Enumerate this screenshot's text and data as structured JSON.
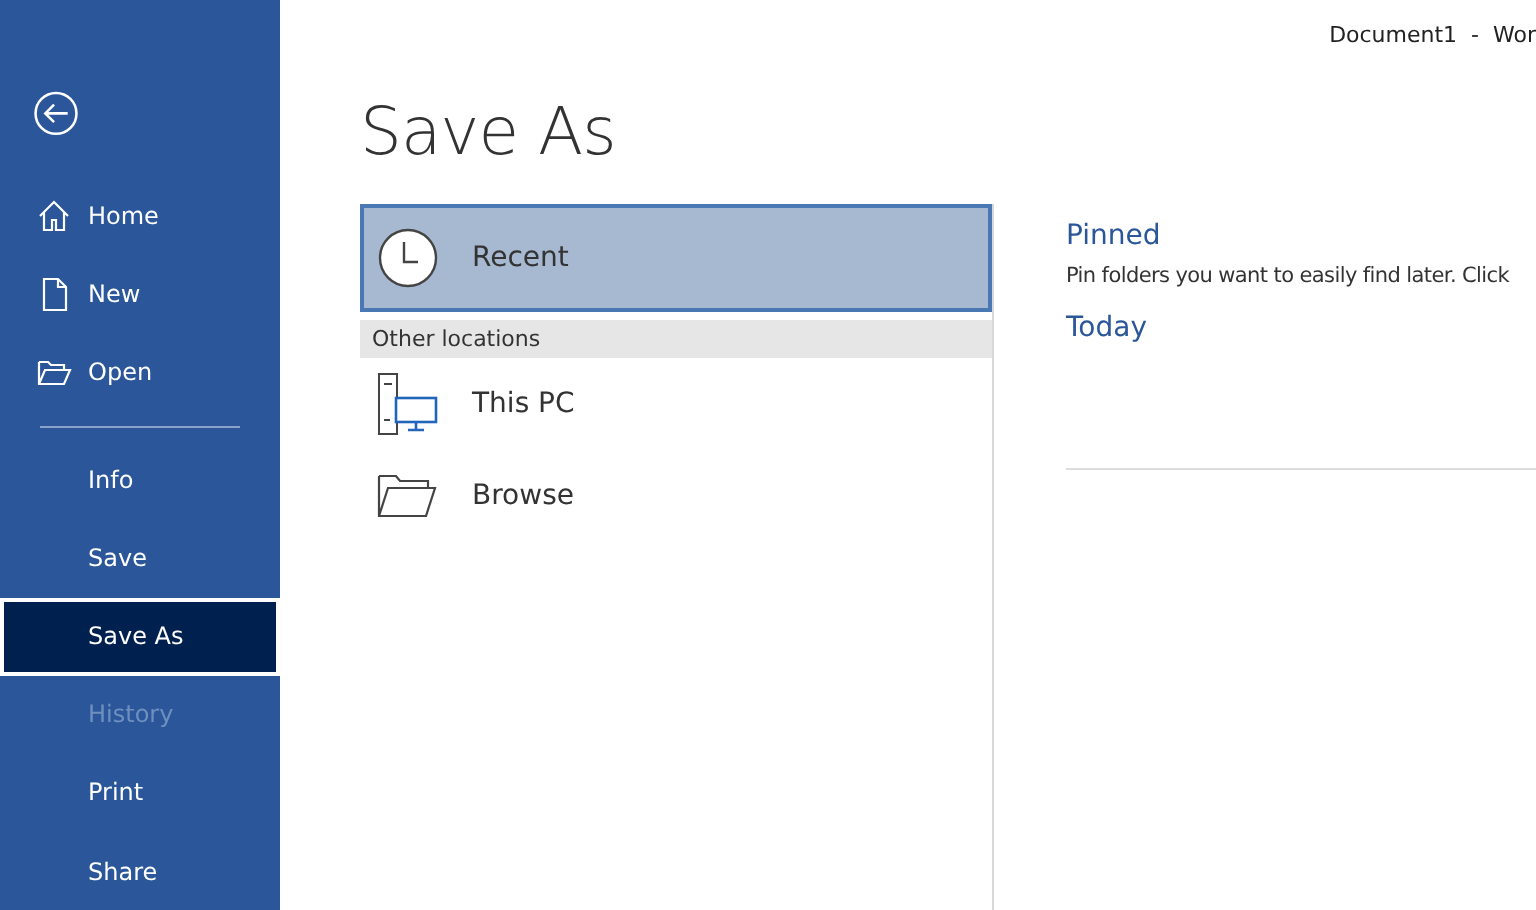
{
  "window": {
    "title": "Document1  -  Wor"
  },
  "sidebar": {
    "groups": [
      [
        {
          "label": "Home",
          "kind": "home",
          "selected": false,
          "disabled": false
        },
        {
          "label": "New",
          "kind": "new",
          "selected": false,
          "disabled": false
        },
        {
          "label": "Open",
          "kind": "open",
          "selected": false,
          "disabled": false
        }
      ],
      [
        {
          "label": "Info",
          "kind": "plain",
          "selected": false,
          "disabled": false
        },
        {
          "label": "Save",
          "kind": "plain",
          "selected": false,
          "disabled": false
        },
        {
          "label": "Save As",
          "kind": "plain",
          "selected": true,
          "disabled": false
        },
        {
          "label": "History",
          "kind": "plain",
          "selected": false,
          "disabled": true
        },
        {
          "label": "Print",
          "kind": "plain",
          "selected": false,
          "disabled": false
        },
        {
          "label": "Share",
          "kind": "plain",
          "selected": false,
          "disabled": false
        }
      ]
    ]
  },
  "page": {
    "heading": "Save As",
    "locations": [
      {
        "label": "Recent",
        "kind": "recent",
        "selected": true
      }
    ],
    "other_heading": "Other locations",
    "other_locations": [
      {
        "label": "This PC",
        "kind": "pc",
        "selected": false
      },
      {
        "label": "Browse",
        "kind": "browse",
        "selected": false
      }
    ],
    "sections": [
      {
        "title": "Pinned",
        "text": "Pin folders you want to easily find later. Click"
      },
      {
        "title": "Today"
      }
    ]
  }
}
